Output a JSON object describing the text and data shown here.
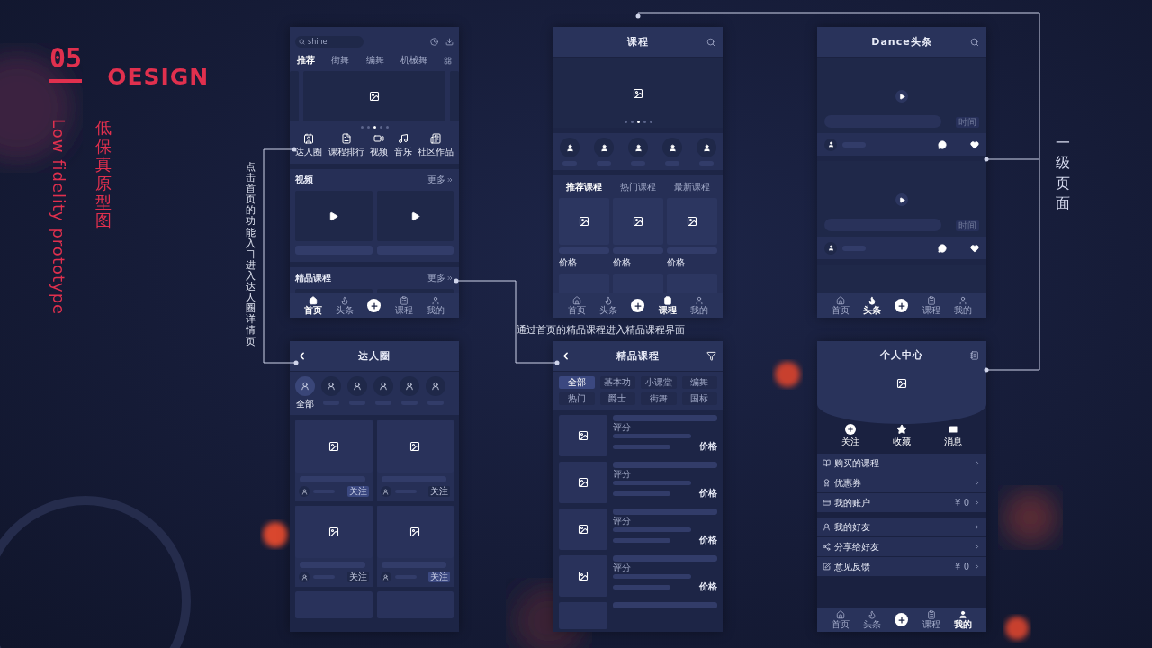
{
  "branding": {
    "number": "05",
    "word": "OESIGN",
    "title_cn": "低保真原型图",
    "title_en": "Low fidelity prototype"
  },
  "annotations": {
    "home_to_experts": "点击首页的功能入口进入达人圈详情页",
    "home_to_featured": "通过首页的精品课程进入精品课程界面",
    "level_one": "一级页面"
  },
  "home": {
    "search": {
      "placeholder": "shine"
    },
    "tabs": [
      {
        "label": "推荐",
        "selected": true
      },
      {
        "label": "街舞",
        "selected": false
      },
      {
        "label": "编舞",
        "selected": false
      },
      {
        "label": "机械舞",
        "selected": false
      }
    ],
    "dots": [
      {
        "selected": false
      },
      {
        "selected": false
      },
      {
        "selected": true
      },
      {
        "selected": false
      },
      {
        "selected": false
      }
    ],
    "shortcuts": [
      {
        "label": "达人圈",
        "kind": "experts"
      },
      {
        "label": "课程排行",
        "kind": "ranking"
      },
      {
        "label": "视频",
        "kind": "video"
      },
      {
        "label": "音乐",
        "kind": "music"
      },
      {
        "label": "社区作品",
        "kind": "works"
      }
    ],
    "video": {
      "title": "视频",
      "more": "更多"
    },
    "featured": {
      "title": "精品课程",
      "more": "更多"
    },
    "tab_bar": [
      {
        "label": "首页",
        "kind": "home",
        "selected": true
      },
      {
        "label": "头条",
        "kind": "news",
        "selected": false
      },
      {
        "kind": "add"
      },
      {
        "label": "课程",
        "kind": "courses",
        "selected": false
      },
      {
        "label": "我的",
        "kind": "me",
        "selected": false
      }
    ]
  },
  "courses": {
    "title": "课程",
    "dots": [
      {
        "selected": false
      },
      {
        "selected": false
      },
      {
        "selected": true
      },
      {
        "selected": false
      },
      {
        "selected": false
      }
    ],
    "categories": [
      {
        "label": "推荐课程",
        "selected": true
      },
      {
        "label": "热门课程",
        "selected": false
      },
      {
        "label": "最新课程",
        "selected": false
      }
    ],
    "cards": [
      {
        "price": "价格"
      },
      {
        "price": "价格"
      },
      {
        "price": "价格"
      }
    ],
    "tab_bar": [
      {
        "label": "首页",
        "kind": "home",
        "selected": false
      },
      {
        "label": "头条",
        "kind": "news",
        "selected": false
      },
      {
        "kind": "add"
      },
      {
        "label": "课程",
        "kind": "courses",
        "selected": true
      },
      {
        "label": "我的",
        "kind": "me",
        "selected": false
      }
    ]
  },
  "dance": {
    "title": "Dance头条",
    "posts": [
      {
        "time": "时间"
      },
      {
        "time": "时间"
      }
    ],
    "tab_bar": [
      {
        "label": "首页",
        "kind": "home",
        "selected": false
      },
      {
        "label": "头条",
        "kind": "news",
        "selected": true
      },
      {
        "kind": "add"
      },
      {
        "label": "课程",
        "kind": "courses",
        "selected": false
      },
      {
        "label": "我的",
        "kind": "me",
        "selected": false
      }
    ]
  },
  "experts": {
    "title": "达人圈",
    "filters": [
      {
        "label": "全部",
        "selected": true
      },
      {
        "selected": false
      },
      {
        "selected": false
      },
      {
        "selected": false
      },
      {
        "selected": false
      },
      {
        "selected": false
      }
    ],
    "cards": [
      {
        "follow": "关注",
        "active": true
      },
      {
        "follow": "关注",
        "active": false
      },
      {
        "follow": "关注",
        "active": false
      },
      {
        "follow": "关注",
        "active": true
      }
    ]
  },
  "featured": {
    "title": "精品课程",
    "filters": [
      {
        "label": "全部",
        "selected": true
      },
      {
        "label": "基本功",
        "selected": false
      },
      {
        "label": "小课堂",
        "selected": false
      },
      {
        "label": "编舞",
        "selected": false
      },
      {
        "label": "热门",
        "selected": false
      },
      {
        "label": "爵士",
        "selected": false
      },
      {
        "label": "街舞",
        "selected": false
      },
      {
        "label": "国标",
        "selected": false
      }
    ],
    "items": [
      {
        "rating": "评分",
        "price": "价格"
      },
      {
        "rating": "评分",
        "price": "价格"
      },
      {
        "rating": "评分",
        "price": "价格"
      },
      {
        "rating": "评分",
        "price": "价格"
      }
    ]
  },
  "profile": {
    "title": "个人中心",
    "actions": [
      {
        "label": "关注",
        "kind": "follow"
      },
      {
        "label": "收藏",
        "kind": "favorite"
      },
      {
        "label": "消息",
        "kind": "message"
      }
    ],
    "menu_groups": [
      [
        {
          "label": "购买的课程",
          "kind": "book"
        },
        {
          "label": "优惠券",
          "kind": "coupon"
        },
        {
          "label": "我的账户",
          "kind": "account",
          "value": "¥ 0"
        }
      ],
      [
        {
          "label": "我的好友",
          "kind": "friends"
        },
        {
          "label": "分享给好友",
          "kind": "share"
        },
        {
          "label": "意见反馈",
          "kind": "feedback",
          "value": "¥ 0"
        }
      ]
    ],
    "tab_bar": [
      {
        "label": "首页",
        "kind": "home",
        "selected": false
      },
      {
        "label": "头条",
        "kind": "news",
        "selected": false
      },
      {
        "kind": "add"
      },
      {
        "label": "课程",
        "kind": "courses",
        "selected": false
      },
      {
        "label": "我的",
        "kind": "me",
        "selected": true
      }
    ]
  }
}
